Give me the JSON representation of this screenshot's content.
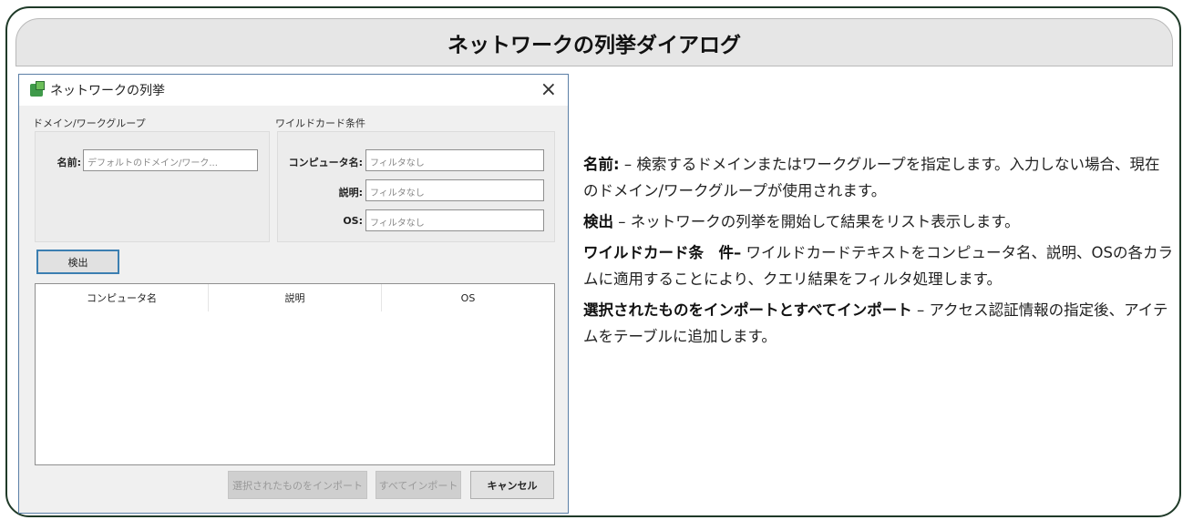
{
  "banner": {
    "title": "ネットワークの列挙ダイアログ"
  },
  "dialog": {
    "title": "ネットワークの列挙",
    "close": "×",
    "domain_group": {
      "legend": "ドメイン/ワークグループ",
      "name_label": "名前:",
      "name_placeholder": "デフォルトのドメイン/ワーク..."
    },
    "wildcard_group": {
      "legend": "ワイルドカード条件",
      "computer_label": "コンピュータ名:",
      "desc_label": "説明:",
      "os_label": "OS:",
      "placeholder": "フィルタなし"
    },
    "search_button": "検出",
    "table": {
      "columns": [
        "コンピュータ名",
        "説明",
        "OS"
      ]
    },
    "buttons": {
      "import_selected": "選択されたものをインポート",
      "import_all": "すべてインポート",
      "cancel": "キャンセル"
    }
  },
  "descriptions": [
    {
      "term": "名前:",
      "text": " – 検索するドメインまたはワークグループを指定します。入力しない場合、現在のドメイン/ワークグループが使用されます。"
    },
    {
      "term": "検出",
      "text": " – ネットワークの列挙を開始して結果をリスト表示します。"
    },
    {
      "term": "ワイルドカード条　件–",
      "text": " ワイルドカードテキストをコンピュータ名、説明、OSの各カラムに適用することにより、クエリ結果をフィルタ処理します。"
    },
    {
      "term": "選択されたものをインポートとすべてインポート",
      "text": " – アクセス認証情報の指定後、アイテムをテーブルに追加します。"
    }
  ]
}
